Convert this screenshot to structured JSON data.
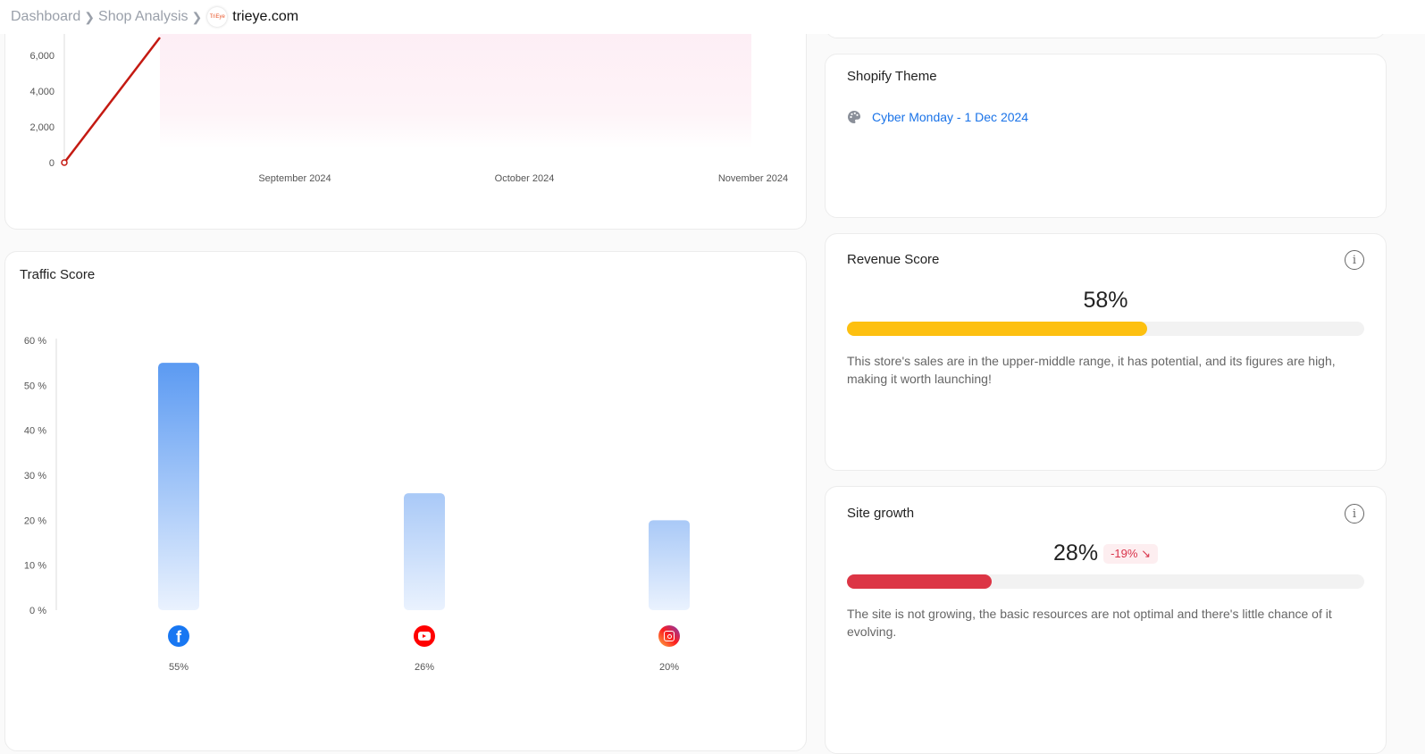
{
  "breadcrumb": {
    "items": [
      "Dashboard",
      "Shop Analysis"
    ],
    "separator": ">",
    "logo_text": "TriEye",
    "current": "trieye.com"
  },
  "colors": {
    "line": "#c41a12",
    "bar_top": "#5b9af2",
    "bar_bottom": "#eaf2fe",
    "revenue_bar": "#fdc010",
    "growth_bar": "#dc3545",
    "link": "#1a73e8"
  },
  "sales_chart": {
    "chart_data": {
      "type": "line",
      "title": "",
      "xlabel": "",
      "ylabel": "",
      "y_ticks": [
        "0",
        "2,000",
        "4,000",
        "6,000"
      ],
      "x_ticks": [
        "September 2024",
        "October 2024",
        "November 2024"
      ],
      "ylim": [
        0,
        7000
      ],
      "points": [
        {
          "x": "start",
          "y": 0
        },
        {
          "x": "early Aug 2024",
          "y": 7000
        }
      ]
    }
  },
  "traffic": {
    "title": "Traffic Score",
    "chart_data": {
      "type": "bar",
      "categories": [
        "Facebook",
        "YouTube",
        "Instagram"
      ],
      "values": [
        55,
        26,
        20
      ],
      "labels": [
        "55%",
        "26%",
        "20%"
      ],
      "y_ticks": [
        "0 %",
        "10 %",
        "20 %",
        "30 %",
        "40 %",
        "50 %",
        "60 %"
      ],
      "ylim": [
        0,
        60
      ],
      "xlabel": "",
      "ylabel": "",
      "title": "Traffic Score"
    }
  },
  "theme": {
    "title": "Shopify Theme",
    "icon": "palette-icon",
    "name": "Cyber Monday - 1 Dec 2024"
  },
  "revenue": {
    "title": "Revenue Score",
    "value": "58%",
    "progress": 58,
    "description": "This store's sales are in the upper-middle range, it has potential, and its figures are high, making it worth launching!"
  },
  "growth": {
    "title": "Site growth",
    "value": "28%",
    "change": "-19%",
    "change_icon": "arrow-down-right-icon",
    "progress": 28,
    "description": "The site is not growing, the basic resources are not optimal and there's little chance of it evolving."
  }
}
